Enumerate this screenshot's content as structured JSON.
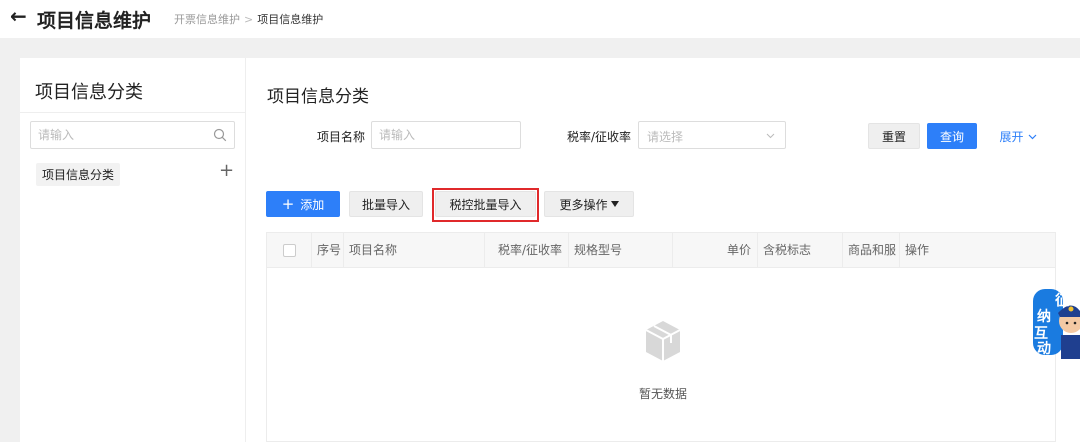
{
  "header": {
    "back_icon": "arrow-left-icon",
    "title": "项目信息维护",
    "breadcrumb": [
      "开票信息维护",
      "项目信息维护"
    ],
    "breadcrumb_separator": ">"
  },
  "sidebar": {
    "title": "项目信息分类",
    "search_placeholder": "请输入",
    "search_icon": "search-icon",
    "tree_items": [
      {
        "label": "项目信息分类"
      }
    ],
    "add_icon": "+"
  },
  "main": {
    "title": "项目信息分类",
    "filters": {
      "name_label": "项目名称",
      "name_placeholder": "请输入",
      "tax_label": "税率/征收率",
      "tax_placeholder": "请选择"
    },
    "actions": {
      "reset": "重置",
      "query": "查询",
      "expand": "展开"
    },
    "toolbar": {
      "add": "添加",
      "batch_import": "批量导入",
      "tax_batch_import": "税控批量导入",
      "more": "更多操作"
    },
    "table": {
      "columns": [
        "序号",
        "项目名称",
        "税率/征收率",
        "规格型号",
        "单价",
        "含税标志",
        "商品和服",
        "操作"
      ],
      "rows": [],
      "empty_text": "暂无数据"
    }
  },
  "mascot": {
    "chars": [
      "征",
      "纳",
      "互",
      "动"
    ]
  },
  "colors": {
    "primary": "#2d7ff9",
    "highlight": "#e0292b",
    "background": "#f0f0f0"
  }
}
